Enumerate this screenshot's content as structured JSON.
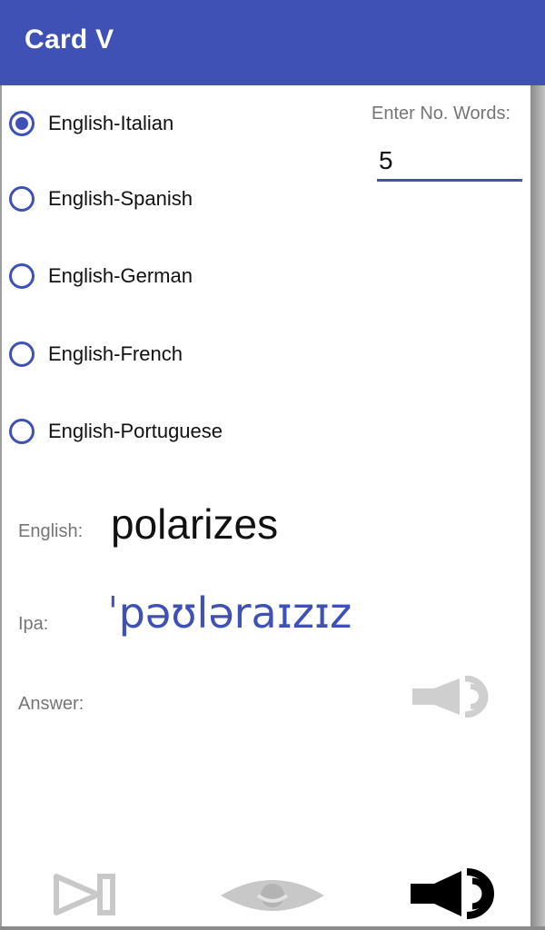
{
  "app_bar": {
    "title": "Card V"
  },
  "languages": [
    {
      "label": "English-Italian",
      "selected": true
    },
    {
      "label": "English-Spanish",
      "selected": false
    },
    {
      "label": "English-German",
      "selected": false
    },
    {
      "label": "English-French",
      "selected": false
    },
    {
      "label": "English-Portuguese",
      "selected": false
    }
  ],
  "word_count": {
    "label": "Enter No. Words:",
    "value": "5"
  },
  "card": {
    "english_label": "English:",
    "english_word": "polarizes",
    "ipa_label": "Ipa:",
    "ipa_word": "ˈpəʊləraɪzɪz",
    "answer_label": "Answer:",
    "answer_value": ""
  },
  "icons": {
    "answer_speaker": "speaker-icon",
    "next": "next-icon",
    "reveal": "eye-icon",
    "play": "speaker-icon"
  },
  "colors": {
    "primary": "#3f51b5",
    "disabled_icon": "#c8c8c8",
    "active_icon": "#000000"
  }
}
